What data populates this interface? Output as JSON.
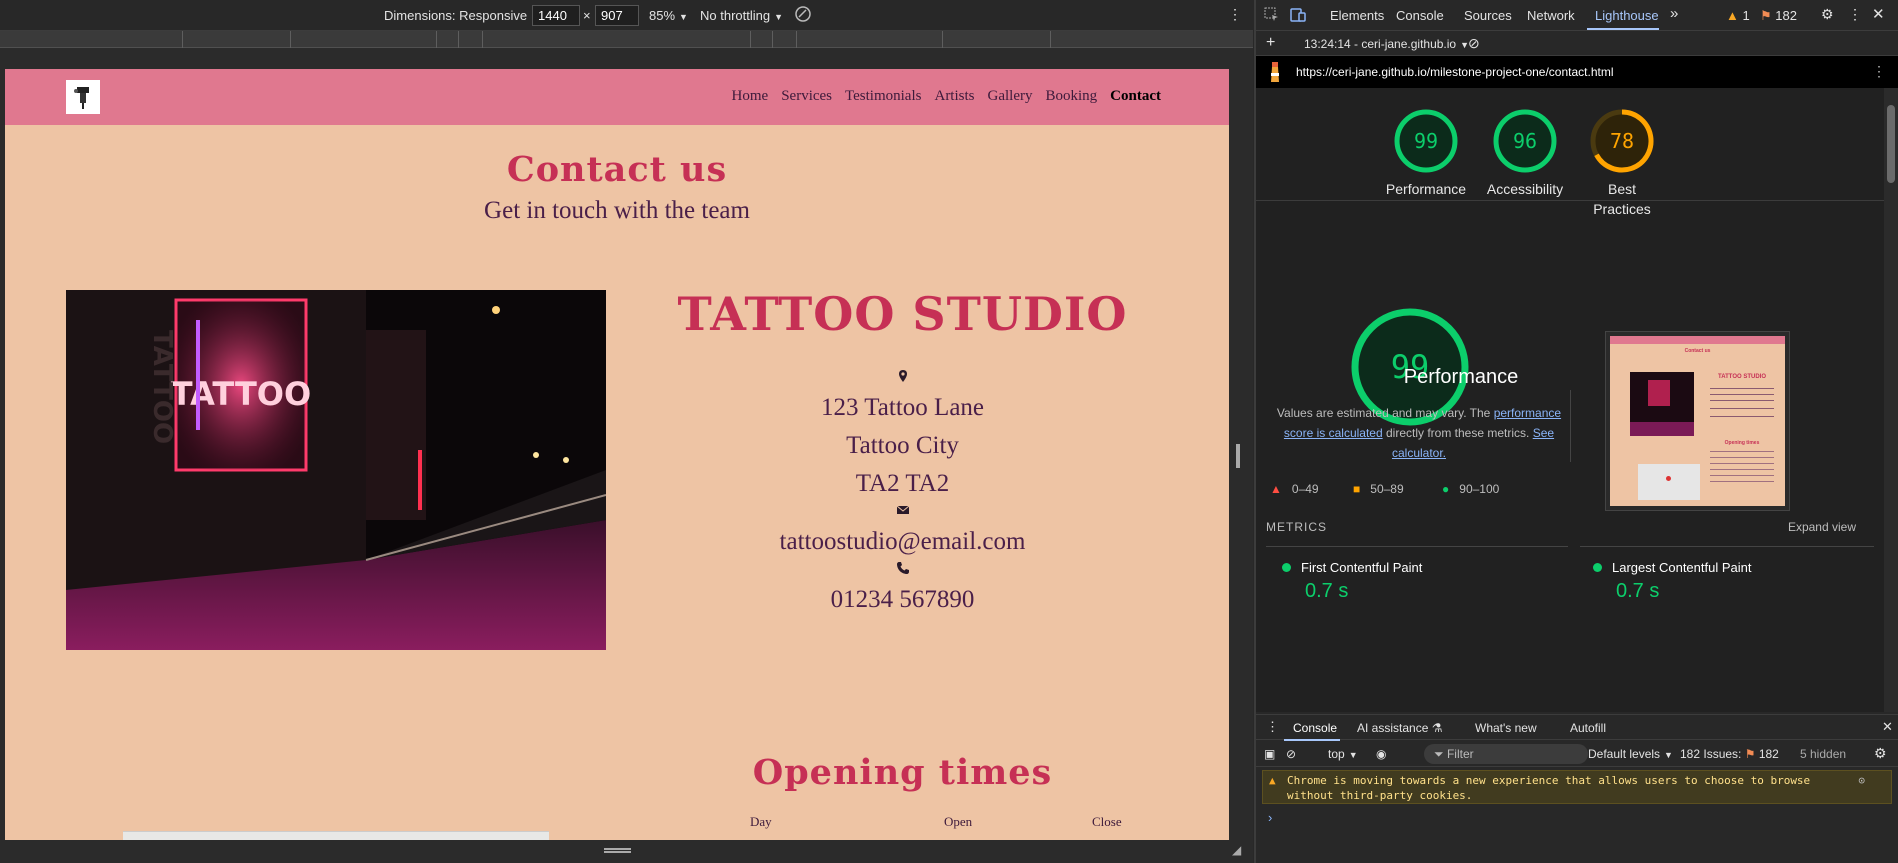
{
  "device_toolbar": {
    "dimensions_label": "Dimensions: Responsive",
    "width": "1440",
    "height": "907",
    "times": "×",
    "zoom": "85%",
    "throttling": "No throttling"
  },
  "site": {
    "nav": [
      "Home",
      "Services",
      "Testimonials",
      "Artists",
      "Gallery",
      "Booking",
      "Contact"
    ],
    "active_nav": "Contact",
    "contact_title": "Contact us",
    "contact_subtitle": "Get in touch with the team",
    "studio_title": "TATTOO STUDIO",
    "address": [
      "123 Tattoo Lane",
      "Tattoo City",
      "TA2 TA2"
    ],
    "email": "tattoostudio@email.com",
    "phone": "01234 567890",
    "opening_title": "Opening times",
    "hours_headers": [
      "Day",
      "Open",
      "Close"
    ],
    "photo_sign_text": "TATTOO"
  },
  "devtools": {
    "tabs": [
      "Elements",
      "Console",
      "Sources",
      "Network",
      "Lighthouse"
    ],
    "active_tab": "Lighthouse",
    "warning_count": "1",
    "issue_count": "182",
    "report_time": "13:24:14 - ceri-jane.github.io",
    "url": "https://ceri-jane.github.io/milestone-project-one/contact.html",
    "scores": [
      {
        "value": "99",
        "label": "Performance",
        "color": "#0cce6b"
      },
      {
        "value": "96",
        "label": "Accessibility",
        "color": "#0cce6b"
      },
      {
        "value": "78",
        "label": "Best Practices",
        "color": "#ffa400"
      }
    ],
    "big_score": "99",
    "big_title": "Performance",
    "desc_prefix": "Values are estimated and may vary. The",
    "desc_link1": "performance score is calculated",
    "desc_middle": "directly from these metrics.",
    "desc_link2": "See calculator.",
    "legend": [
      "0–49",
      "50–89",
      "90–100"
    ],
    "metrics_title": "METRICS",
    "expand_view": "Expand view",
    "metrics": [
      {
        "label": "First Contentful Paint",
        "value": "0.7 s"
      },
      {
        "label": "Largest Contentful Paint",
        "value": "0.7 s"
      }
    ]
  },
  "drawer": {
    "tabs": [
      "Console",
      "AI assistance",
      "What's new",
      "Autofill"
    ],
    "context": "top",
    "filter_placeholder": "Filter",
    "levels": "Default levels",
    "issues_label": "182 Issues:",
    "issues_count": "182",
    "hidden": "5 hidden",
    "warning_line1": "Chrome is moving towards a new experience that allows users to choose to browse",
    "warning_line2": "without third-party cookies.",
    "prompt": "›"
  },
  "colors": {
    "site_nav": "#e0788f",
    "site_bg": "#eec4a4",
    "heading": "#c63055",
    "text": "#4a1f49",
    "pass": "#0cce6b",
    "average": "#ffa400",
    "fail": "#ff4e42"
  }
}
